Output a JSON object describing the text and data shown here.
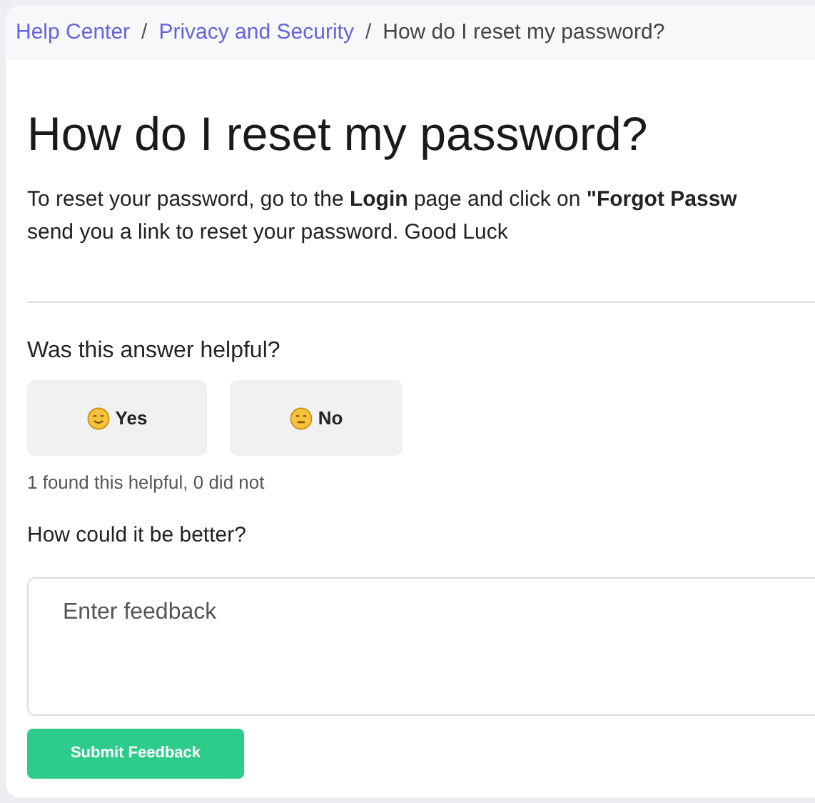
{
  "breadcrumb": [
    {
      "label": "Help Center",
      "kind": "link"
    },
    {
      "label": "Privacy and Security",
      "kind": "link"
    },
    {
      "label": "How do I reset my password?",
      "kind": "current"
    }
  ],
  "separator": "/",
  "title": "How do I reset my password?",
  "body_lines": [
    "To reset your password, go to the **Login** page and click on **\"Forgot Passw**",
    "send you a link to reset your password. Good Luck"
  ],
  "feedback": {
    "question": "Was this answer helpful?",
    "buttons": [
      {
        "label": "Yes",
        "kind": "smile"
      },
      {
        "label": "No",
        "kind": "meh"
      }
    ],
    "stats": "1 found this helpful, 0 did not",
    "improve_label": "How could it be better?",
    "placeholder": "Enter feedback",
    "submit": "Submit Feedback"
  }
}
